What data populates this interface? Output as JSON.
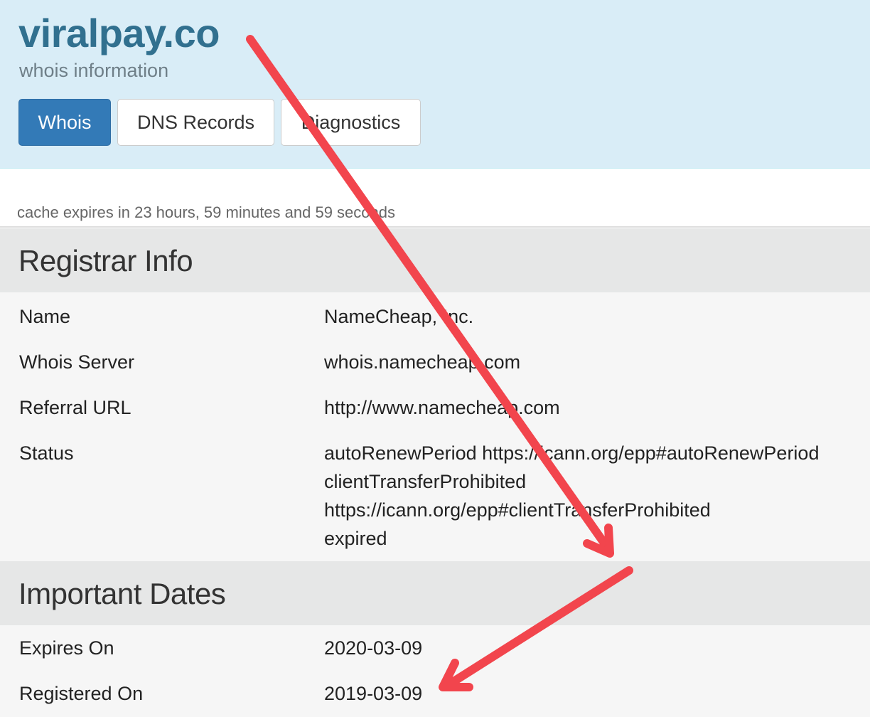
{
  "header": {
    "domain": "viralpay.co",
    "subtitle": "whois information",
    "tabs": [
      {
        "label": "Whois",
        "active": true
      },
      {
        "label": "DNS Records",
        "active": false
      },
      {
        "label": "Diagnostics",
        "active": false
      }
    ]
  },
  "cache_notice": "cache expires in 23 hours, 59 minutes and 59 seconds",
  "registrar": {
    "heading": "Registrar Info",
    "rows": [
      {
        "label": "Name",
        "value": "NameCheap, Inc."
      },
      {
        "label": "Whois Server",
        "value": "whois.namecheap.com"
      },
      {
        "label": "Referral URL",
        "value": "http://www.namecheap.com"
      }
    ],
    "status": {
      "label": "Status",
      "lines": [
        "autoRenewPeriod https://icann.org/epp#autoRenewPeriod",
        "clientTransferProhibited",
        "https://icann.org/epp#clientTransferProhibited",
        "expired"
      ]
    }
  },
  "dates": {
    "heading": "Important Dates",
    "rows": [
      {
        "label": "Expires On",
        "value": "2020-03-09"
      },
      {
        "label": "Registered On",
        "value": "2019-03-09"
      }
    ]
  },
  "colors": {
    "header_bg": "#d9edf7",
    "brand": "#31708f",
    "tab_active": "#337ab7",
    "section_bg": "#e6e7e7",
    "body_bg": "#f6f6f6",
    "arrow": "#f2454d"
  },
  "icons": [
    "arrow-annotation-icon"
  ]
}
